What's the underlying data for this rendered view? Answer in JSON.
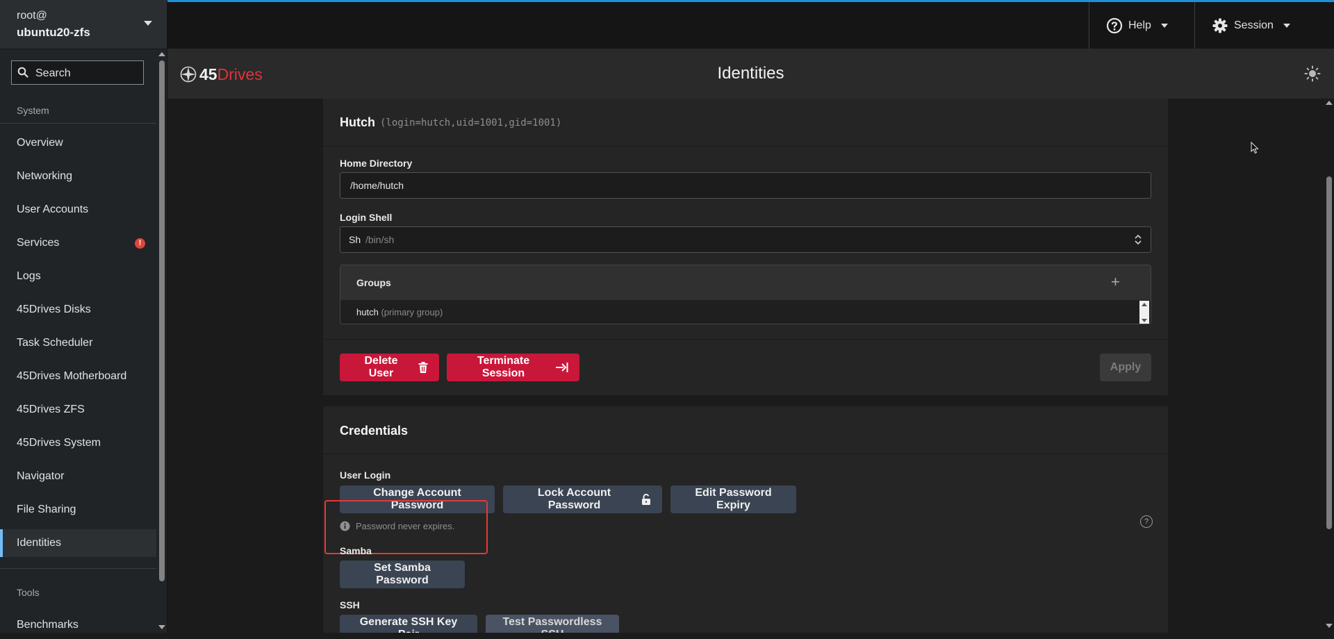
{
  "host": {
    "user": "root@",
    "name": "ubuntu20-zfs"
  },
  "search": {
    "placeholder": "Search"
  },
  "nav": {
    "system_heading": "System",
    "items": [
      {
        "label": "Overview"
      },
      {
        "label": "Networking"
      },
      {
        "label": "User Accounts"
      },
      {
        "label": "Services"
      },
      {
        "label": "Logs"
      },
      {
        "label": "45Drives Disks"
      },
      {
        "label": "Task Scheduler"
      },
      {
        "label": "45Drives Motherboard"
      },
      {
        "label": "45Drives ZFS"
      },
      {
        "label": "45Drives System"
      },
      {
        "label": "Navigator"
      },
      {
        "label": "File Sharing"
      },
      {
        "label": "Identities"
      }
    ],
    "services_alert": "!",
    "tools_heading": "Tools",
    "tools_items": [
      {
        "label": "Benchmarks"
      }
    ]
  },
  "topbar": {
    "help_label": "Help",
    "session_label": "Session"
  },
  "header": {
    "logo_num": "45",
    "logo_word": "Drives",
    "title": "Identities"
  },
  "user_card": {
    "name": "Hutch",
    "meta": "(login=hutch,uid=1001,gid=1001)",
    "home_dir_label": "Home Directory",
    "home_dir_value": "/home/hutch",
    "shell_label": "Login Shell",
    "shell_name": "Sh",
    "shell_path": "/bin/sh",
    "groups_title": "Groups",
    "groups": [
      {
        "name": "hutch",
        "note": "(primary group)"
      }
    ],
    "delete_label": "Delete User",
    "terminate_label": "Terminate Session",
    "apply_label": "Apply"
  },
  "credentials": {
    "title": "Credentials",
    "user_login_label": "User Login",
    "change_pw_label": "Change Account Password",
    "lock_pw_label": "Lock Account Password",
    "expiry_label": "Edit Password Expiry",
    "expiry_note": "Password never expires.",
    "samba_label": "Samba",
    "samba_btn_label": "Set Samba Password",
    "ssh_label": "SSH",
    "ssh_gen_label": "Generate SSH Key Pair",
    "ssh_test_label": "Test Passwordless SSH"
  },
  "colors": {
    "accent": "#1e90d9",
    "danger": "#c9173a",
    "brand_red": "#e0333b",
    "highlight": "#e53935",
    "active_nav": "#73bcf7"
  }
}
